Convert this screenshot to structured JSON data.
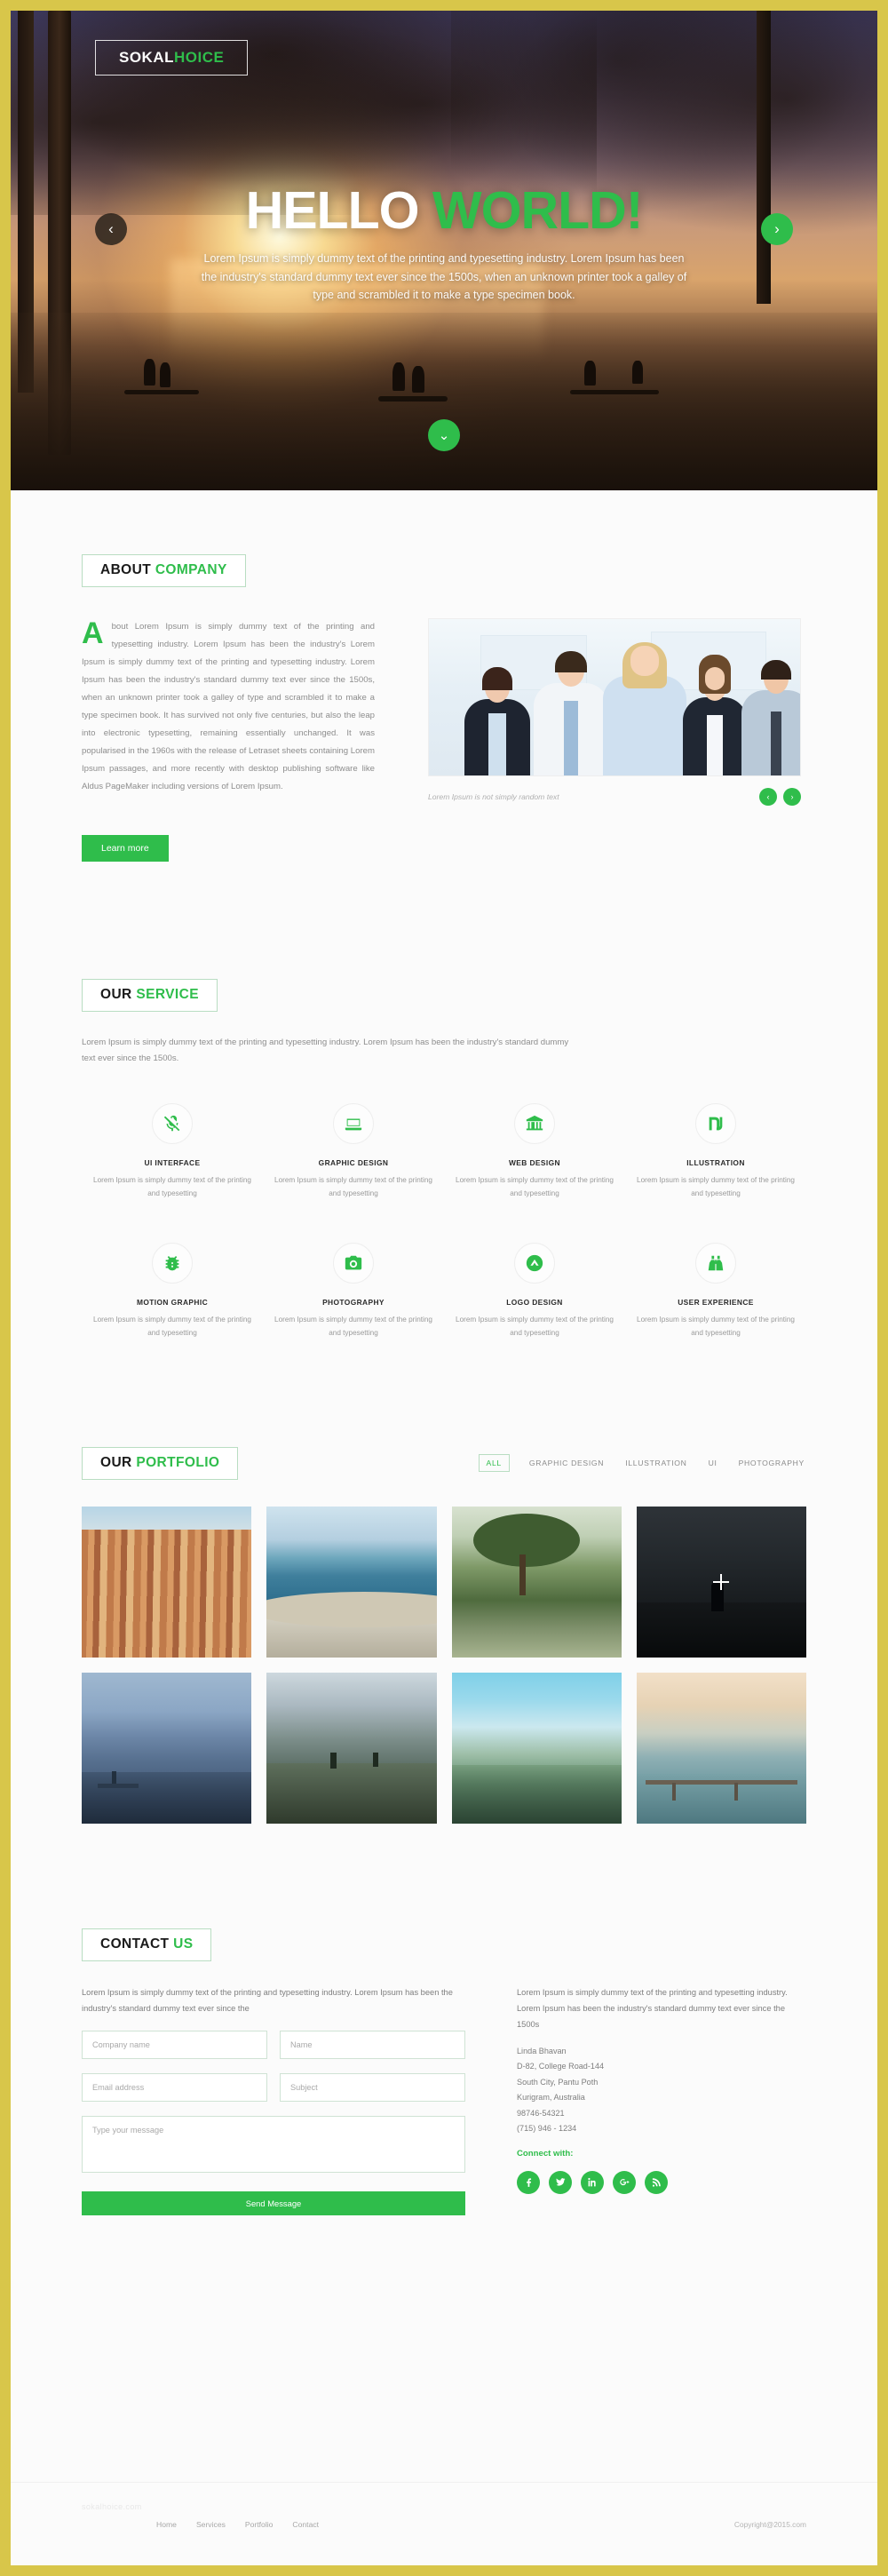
{
  "brand": {
    "name_part1": "SOKAL",
    "name_part2": "HOICE"
  },
  "hero": {
    "title_white": "HELLO ",
    "title_green": "WORLD!",
    "subtitle": "Lorem Ipsum is simply dummy text of the printing and typesetting industry. Lorem Ipsum has been the industry's standard dummy text ever since the 1500s, when an unknown printer took a galley of type and scrambled it to make a type specimen book.",
    "prev_icon": "‹",
    "next_icon": "›",
    "scroll_icon": "⌄"
  },
  "about": {
    "title_a": "ABOUT ",
    "title_b": "COMPANY",
    "dropcap": "A",
    "body": "bout Lorem Ipsum is simply dummy text of the printing and typesetting industry. Lorem Ipsum has been the industry's Lorem Ipsum is simply dummy text of the printing and typesetting industry. Lorem Ipsum has been the industry's standard dummy text ever since the 1500s, when an unknown printer took a galley of type and scrambled it to make a type specimen book. It has survived not only five centuries, but also the leap into electronic typesetting, remaining essentially unchanged. It was popularised in the 1960s with the release of Letraset sheets containing Lorem Ipsum passages, and more recently with desktop publishing software like Aldus PageMaker including versions of Lorem Ipsum.",
    "button": "Learn more",
    "caption": "Lorem Ipsum is not simply random text",
    "prev_icon": "‹",
    "next_icon": "›"
  },
  "services": {
    "title_a": "OUR ",
    "title_b": "SERVICE",
    "intro": "Lorem Ipsum is simply dummy text of the printing and typesetting industry. Lorem Ipsum has been the industry's standard dummy text ever since the 1500s.",
    "items": [
      {
        "icon": "microphone-slash-icon",
        "name": "UI INTERFACE",
        "desc": "Lorem Ipsum is simply dummy text of the printing and typesetting"
      },
      {
        "icon": "laptop-icon",
        "name": "GRAPHIC DESIGN",
        "desc": "Lorem Ipsum is simply dummy text of the printing and typesetting"
      },
      {
        "icon": "bank-icon",
        "name": "WEB DESIGN",
        "desc": "Lorem Ipsum is simply dummy text of the printing and typesetting"
      },
      {
        "icon": "shekel-icon",
        "name": "ILLUSTRATION",
        "desc": "Lorem Ipsum is simply dummy text of the printing and typesetting"
      },
      {
        "icon": "bug-icon",
        "name": "MOTION GRAPHIC",
        "desc": "Lorem Ipsum is simply dummy text of the printing and typesetting"
      },
      {
        "icon": "camera-icon",
        "name": "PHOTOGRAPHY",
        "desc": "Lorem Ipsum is simply dummy text of the printing and typesetting"
      },
      {
        "icon": "chevron-up-circle-icon",
        "name": "LOGO DESIGN",
        "desc": "Lorem Ipsum is simply dummy text of the printing and typesetting"
      },
      {
        "icon": "binoculars-icon",
        "name": "USER EXPERIENCE",
        "desc": "Lorem Ipsum is simply dummy text of the printing and typesetting"
      }
    ]
  },
  "portfolio": {
    "title_a": "OUR ",
    "title_b": "PORTFOLIO",
    "filters": [
      {
        "label": "ALL",
        "active": true
      },
      {
        "label": "GRAPHIC DESIGN",
        "active": false
      },
      {
        "label": "ILLUSTRATION",
        "active": false
      },
      {
        "label": "UI",
        "active": false
      },
      {
        "label": "PHOTOGRAPHY",
        "active": false
      }
    ],
    "items": [
      {
        "style": "img-village",
        "alt": "colorful hillside village"
      },
      {
        "style": "img-coast",
        "alt": "rocky coastline aerial"
      },
      {
        "style": "img-cliff",
        "alt": "pine tree on cliff"
      },
      {
        "style": "img-night",
        "alt": "person in dark landscape",
        "hover": true,
        "hover_icon": "plus-icon"
      },
      {
        "style": "img-lakeboat",
        "alt": "lake with pier at dusk"
      },
      {
        "style": "img-mountain",
        "alt": "hikers on mountain ridge"
      },
      {
        "style": "img-fog",
        "alt": "foggy valley sunrise"
      },
      {
        "style": "img-pier",
        "alt": "long wooden pier over sea"
      }
    ]
  },
  "contact": {
    "title_a": "CONTACT ",
    "title_b": "US",
    "intro": "Lorem Ipsum is simply dummy text of the printing and typesetting industry. Lorem Ipsum has been the industry's standard dummy text ever since the",
    "fields": {
      "company": "Company name",
      "name": "Name",
      "email": "Email address",
      "subject": "Subject",
      "message": "Type your message"
    },
    "send_label": "Send Message",
    "right_intro": "Lorem Ipsum is simply dummy text of the printing and typesetting industry. Lorem Ipsum has been the industry's standard dummy text ever since the 1500s",
    "address": [
      "Linda Bhavan",
      "D-82, College Road-144",
      "South City, Pantu Poth",
      "Kurigram,  Australia",
      "98746-54321",
      "(715) 946 - 1234"
    ],
    "connect_label": "Connect ",
    "connect_label_green": "with:",
    "socials": [
      {
        "icon": "facebook-icon"
      },
      {
        "icon": "twitter-icon"
      },
      {
        "icon": "linkedin-icon"
      },
      {
        "icon": "google-plus-icon"
      },
      {
        "icon": "rss-icon"
      }
    ]
  },
  "footer": {
    "logo": "sokalhoice.com",
    "links": [
      "Home",
      "Services",
      "Portfolio",
      "Contact"
    ],
    "copyright": "Copyright@2015.com"
  },
  "colors": {
    "accent": "#2fbd4b",
    "frame": "#d8c64a",
    "page_bg": "#fbfbfb",
    "text_muted": "#8d8d8d"
  }
}
